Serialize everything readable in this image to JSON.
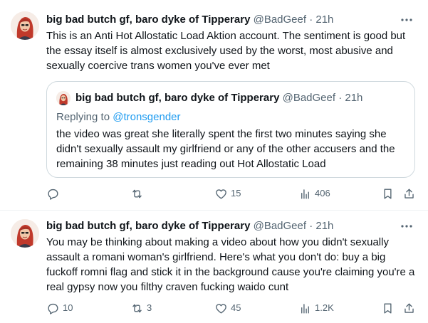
{
  "tweets": [
    {
      "author": {
        "name": "big bad butch gf, baro dyke of Tipperary",
        "handle": "@BadGeef",
        "separator": "·",
        "time": "21h"
      },
      "text": "This is an Anti Hot Allostatic Load Aktion account. The sentiment is good but the essay itself is almost exclusively used by the worst, most abusive and sexually coercive trans women you've ever met",
      "quote": {
        "author": {
          "name": "big bad butch gf, baro dyke of Tipperary",
          "handle": "@BadGeef",
          "separator": "·",
          "time": "21h"
        },
        "replying_prefix": "Replying to ",
        "replying_to": "@tronsgender",
        "text": "the video was great she literally spent the first two minutes saying she didn't sexually assault my girlfriend or any of the other accusers and the remaining 38 minutes just reading out Hot Allostatic Load"
      },
      "actions": {
        "replies": "",
        "retweets": "",
        "likes": "15",
        "views": "406"
      }
    },
    {
      "author": {
        "name": "big bad butch gf, baro dyke of Tipperary",
        "handle": "@BadGeef",
        "separator": "·",
        "time": "21h"
      },
      "text": "You may be thinking about making a video about how you didn't sexually assault a romani woman's girlfriend. Here's what you don't do: buy a big fuckoff romni flag and stick it in the background cause you're claiming you're a real gypsy now you filthy craven fucking waido cunt",
      "actions": {
        "replies": "10",
        "retweets": "3",
        "likes": "45",
        "views": "1.2K"
      }
    }
  ],
  "icons": {
    "more": "more-dots-icon",
    "reply": "reply-bubble-icon",
    "retweet": "retweet-icon",
    "like": "heart-icon",
    "views": "views-bar-chart-icon",
    "bookmark": "bookmark-icon",
    "share": "share-upload-icon"
  },
  "colors": {
    "text": "#0f1419",
    "secondary": "#536471",
    "link": "#1d9bf0",
    "border": "#cfd9de",
    "divider": "#eff3f4"
  }
}
